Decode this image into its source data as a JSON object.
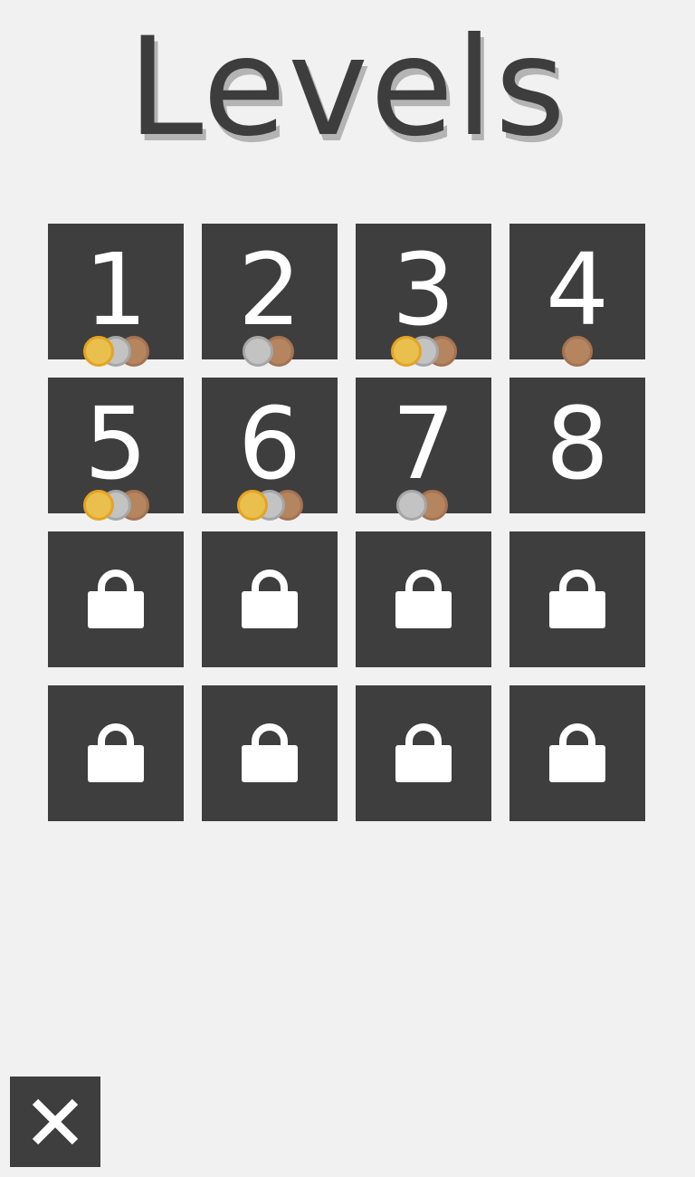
{
  "title": "Levels",
  "levels": [
    {
      "label": "1",
      "locked": false,
      "medals": [
        "gold",
        "silver",
        "bronze"
      ]
    },
    {
      "label": "2",
      "locked": false,
      "medals": [
        "silver",
        "bronze"
      ]
    },
    {
      "label": "3",
      "locked": false,
      "medals": [
        "gold",
        "silver",
        "bronze"
      ]
    },
    {
      "label": "4",
      "locked": false,
      "medals": [
        "bronze"
      ]
    },
    {
      "label": "5",
      "locked": false,
      "medals": [
        "gold",
        "silver",
        "bronze"
      ]
    },
    {
      "label": "6",
      "locked": false,
      "medals": [
        "gold",
        "silver",
        "bronze"
      ]
    },
    {
      "label": "7",
      "locked": false,
      "medals": [
        "silver",
        "bronze"
      ]
    },
    {
      "label": "8",
      "locked": false,
      "medals": []
    },
    {
      "label": "",
      "locked": true,
      "medals": []
    },
    {
      "label": "",
      "locked": true,
      "medals": []
    },
    {
      "label": "",
      "locked": true,
      "medals": []
    },
    {
      "label": "",
      "locked": true,
      "medals": []
    },
    {
      "label": "",
      "locked": true,
      "medals": []
    },
    {
      "label": "",
      "locked": true,
      "medals": []
    },
    {
      "label": "",
      "locked": true,
      "medals": []
    },
    {
      "label": "",
      "locked": true,
      "medals": []
    }
  ],
  "close_icon": "close-icon",
  "lock_icon": "lock-icon",
  "colors": {
    "background": "#f1f1f1",
    "tile": "#3e3e3e",
    "gold": "#e9bf4d",
    "silver": "#c3c3c3",
    "bronze": "#b5855f"
  }
}
